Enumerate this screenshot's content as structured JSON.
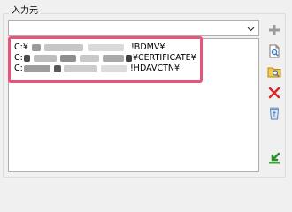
{
  "group": {
    "title": "入力元"
  },
  "combo": {
    "value": ""
  },
  "list": {
    "items": [
      {
        "prefix": "C:¥",
        "suffix": "!BDMV¥"
      },
      {
        "prefix": "C:",
        "suffix": "¥CERTIFICATE¥"
      },
      {
        "prefix": "C:",
        "suffix": "!HDAVCTN¥"
      }
    ]
  },
  "buttons": {
    "add": "plus-icon",
    "browse_file": "document-search-icon",
    "browse_folder": "folder-search-icon",
    "remove": "red-x-icon",
    "clear": "recycle-bin-icon",
    "import": "green-arrow-icon"
  },
  "colors": {
    "highlight": "#e6557c"
  }
}
